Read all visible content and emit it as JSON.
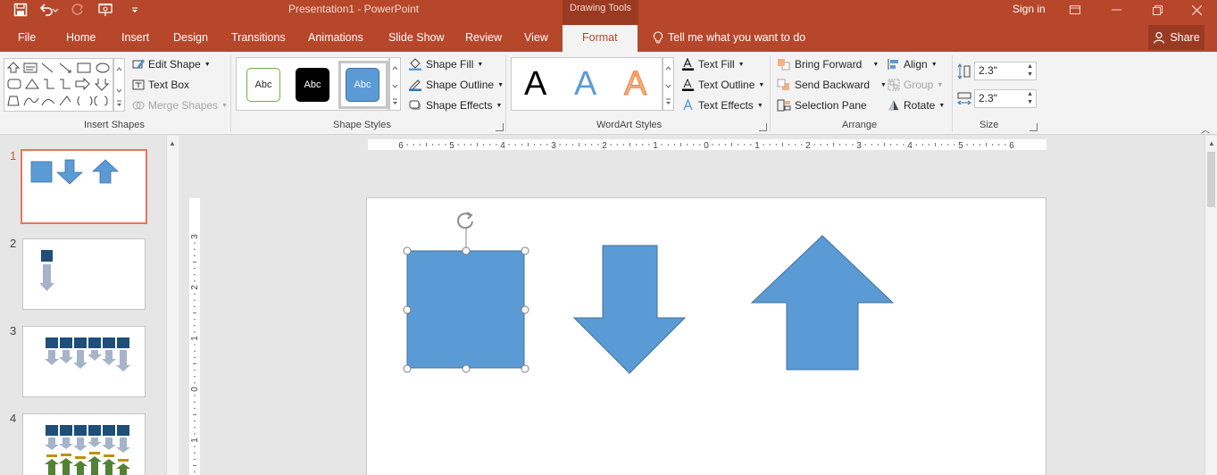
{
  "window": {
    "title": "Presentation1 - PowerPoint",
    "context_tab_group": "Drawing Tools",
    "sign_in": "Sign in"
  },
  "quick_access": {
    "icons": [
      "save-icon",
      "undo-icon",
      "redo-icon",
      "slideshow-from-start-icon",
      "customize-qat-icon"
    ]
  },
  "tabs": [
    {
      "label": "File"
    },
    {
      "label": "Home"
    },
    {
      "label": "Insert"
    },
    {
      "label": "Design"
    },
    {
      "label": "Transitions"
    },
    {
      "label": "Animations"
    },
    {
      "label": "Slide Show"
    },
    {
      "label": "Review"
    },
    {
      "label": "View"
    },
    {
      "label": "Format",
      "active": true
    }
  ],
  "tell_me": "Tell me what you want to do",
  "share": "Share",
  "ribbon": {
    "insert_shapes": {
      "edit_shape": "Edit Shape",
      "text_box": "Text Box",
      "merge_shapes": "Merge Shapes",
      "label": "Insert Shapes"
    },
    "shape_styles": {
      "swatches": [
        {
          "text": "Abc",
          "fill": "#ffffff",
          "border": "#70ad47",
          "color": "#262626"
        },
        {
          "text": "Abc",
          "fill": "#000000",
          "border": "#000000",
          "color": "#ffffff"
        },
        {
          "text": "Abc",
          "fill": "#5b9bd5",
          "border": "#41719c",
          "color": "#ffffff",
          "selected": true
        }
      ],
      "shape_fill": "Shape Fill",
      "shape_outline": "Shape Outline",
      "shape_effects": "Shape Effects",
      "label": "Shape Styles"
    },
    "wordart_styles": {
      "samples": [
        "A",
        "A",
        "A"
      ],
      "text_fill": "Text Fill",
      "text_outline": "Text Outline",
      "text_effects": "Text Effects",
      "label": "WordArt Styles"
    },
    "arrange": {
      "bring_forward": "Bring Forward",
      "send_backward": "Send Backward",
      "selection_pane": "Selection Pane",
      "align": "Align",
      "group": "Group",
      "rotate": "Rotate",
      "label": "Arrange"
    },
    "size": {
      "height": "2.3\"",
      "width": "2.3\"",
      "label": "Size"
    }
  },
  "slides": [
    {
      "number": "1",
      "active": true
    },
    {
      "number": "2"
    },
    {
      "number": "3"
    },
    {
      "number": "4"
    }
  ],
  "ruler": {
    "horizontal_labels": [
      "6",
      "5",
      "4",
      "3",
      "2",
      "1",
      "0",
      "1",
      "2",
      "3",
      "4",
      "5",
      "6"
    ],
    "vertical_labels": [
      "3",
      "2",
      "1",
      "0",
      "1"
    ]
  },
  "colors": {
    "accent": "#b7472a",
    "shape_fill": "#5b9bd5",
    "shape_border": "#41719c",
    "dark_blue": "#1f4e79",
    "gray_arrow": "#a5b4c8",
    "green": "#548235",
    "gold": "#bf9000"
  }
}
